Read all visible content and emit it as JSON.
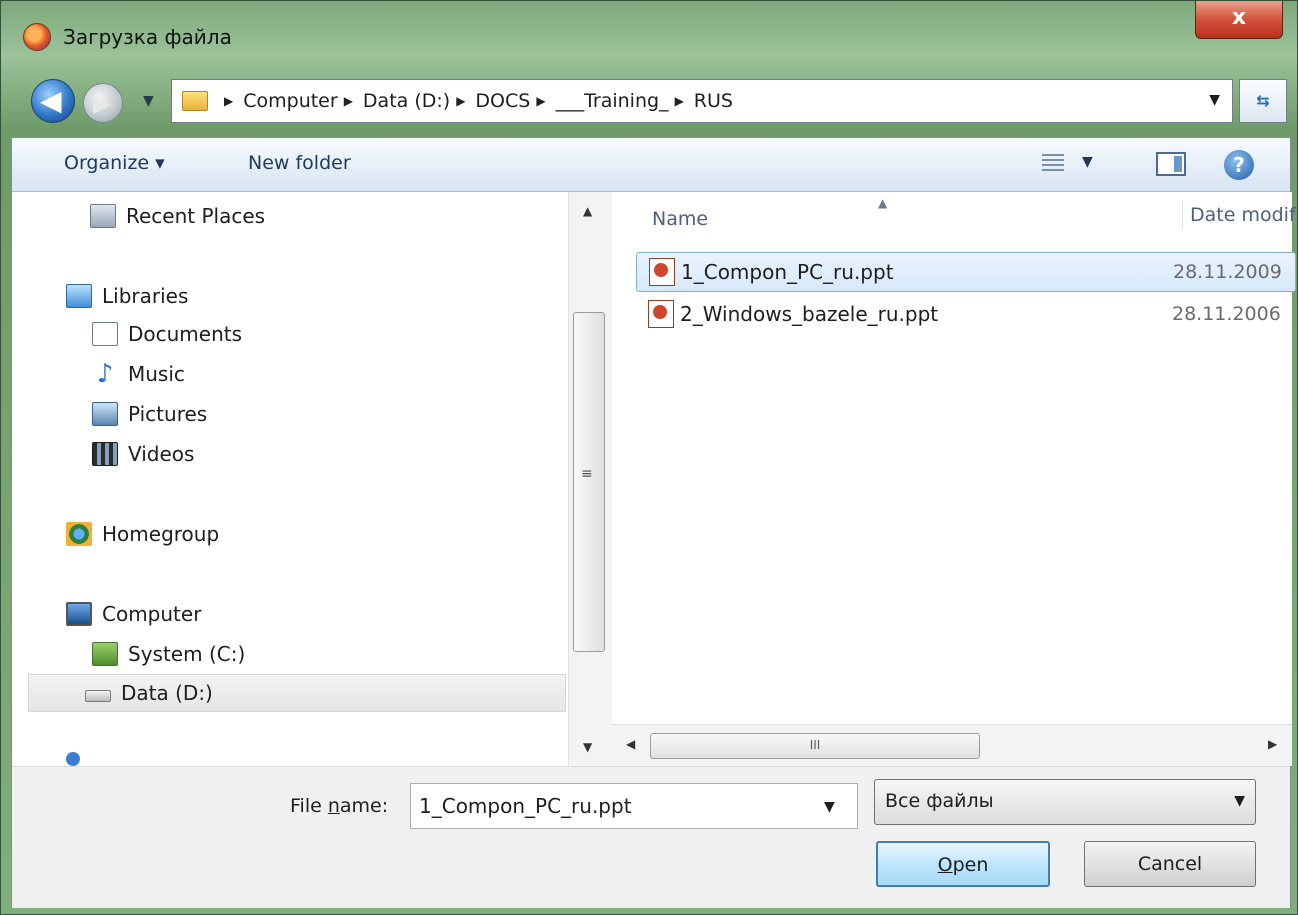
{
  "window": {
    "title": "Загрузка файла",
    "close_glyph": "x"
  },
  "address_bar": {
    "crumbs": [
      "Computer",
      "Data (D:)",
      "DOCS",
      "___Training_",
      "RUS"
    ]
  },
  "toolbar": {
    "organize": "Organize ▾",
    "new_folder": "New folder",
    "help_glyph": "?"
  },
  "nav_pane": {
    "items": [
      {
        "label": "Recent Places",
        "icon": "recent-places-icon"
      },
      {
        "label": "Libraries",
        "icon": "libraries-icon"
      },
      {
        "label": "Documents",
        "icon": "documents-icon"
      },
      {
        "label": "Music",
        "icon": "music-icon"
      },
      {
        "label": "Pictures",
        "icon": "pictures-icon"
      },
      {
        "label": "Videos",
        "icon": "videos-icon"
      },
      {
        "label": "Homegroup",
        "icon": "homegroup-icon"
      },
      {
        "label": "Computer",
        "icon": "computer-icon"
      },
      {
        "label": "System (C:)",
        "icon": "system-drive-icon"
      },
      {
        "label": "Data (D:)",
        "icon": "data-drive-icon",
        "selected": true
      }
    ]
  },
  "file_list": {
    "columns": {
      "name": "Name",
      "date": "Date modif"
    },
    "files": [
      {
        "name": "1_Compon_PC_ru.ppt",
        "date": "28.11.2009",
        "selected": true
      },
      {
        "name": "2_Windows_bazele_ru.ppt",
        "date": "28.11.2006",
        "selected": false
      }
    ],
    "hscroll_grip": "III"
  },
  "footer": {
    "file_name_label_pre": "File ",
    "file_name_label_u": "n",
    "file_name_label_post": "ame:",
    "file_name_value": "1_Compon_PC_ru.ppt",
    "file_type": "Все файлы",
    "open_u": "O",
    "open_rest": "pen",
    "cancel": "Cancel"
  },
  "colors": {
    "frame": "#6f9a6a",
    "selection": "#d7e8fa",
    "close": "#c8432b"
  }
}
